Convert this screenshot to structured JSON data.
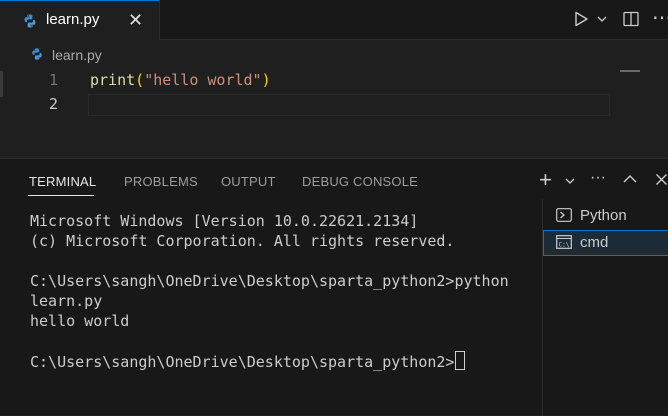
{
  "editor_tab": {
    "label": "learn.py",
    "close": "✕",
    "icon": "python-file-icon"
  },
  "toolbar": {
    "run_icon": "play-icon",
    "split_icon": "split-editor-icon"
  },
  "breadcrumb": {
    "label": "learn.py"
  },
  "code_lines": [
    {
      "number": "1",
      "fn": "print",
      "open": "(",
      "string": "\"hello world\"",
      "close": ")"
    },
    {
      "number": "2"
    }
  ],
  "panel": {
    "tabs": [
      {
        "label": "TERMINAL",
        "active": true
      },
      {
        "label": "PROBLEMS"
      },
      {
        "label": "OUTPUT"
      },
      {
        "label": "DEBUG CONSOLE"
      }
    ],
    "actions": {
      "new": "+",
      "more": "···"
    }
  },
  "terminal": {
    "lines": [
      "Microsoft Windows [Version 10.0.22621.2134]",
      "(c) Microsoft Corporation. All rights reserved.",
      "",
      "C:\\Users\\sangh\\OneDrive\\Desktop\\sparta_python2>python",
      "learn.py",
      "hello world",
      ""
    ],
    "prompt": "C:\\Users\\sangh\\OneDrive\\Desktop\\sparta_python2>"
  },
  "terminal_list": [
    {
      "label": "Python",
      "icon": "terminal-icon"
    },
    {
      "label": "cmd",
      "icon": "cmd-icon",
      "selected": true
    }
  ],
  "colors": {
    "accent": "#0078d4",
    "function": "#dcdcaa",
    "string": "#ce9178",
    "bracket": "#ffd700"
  }
}
